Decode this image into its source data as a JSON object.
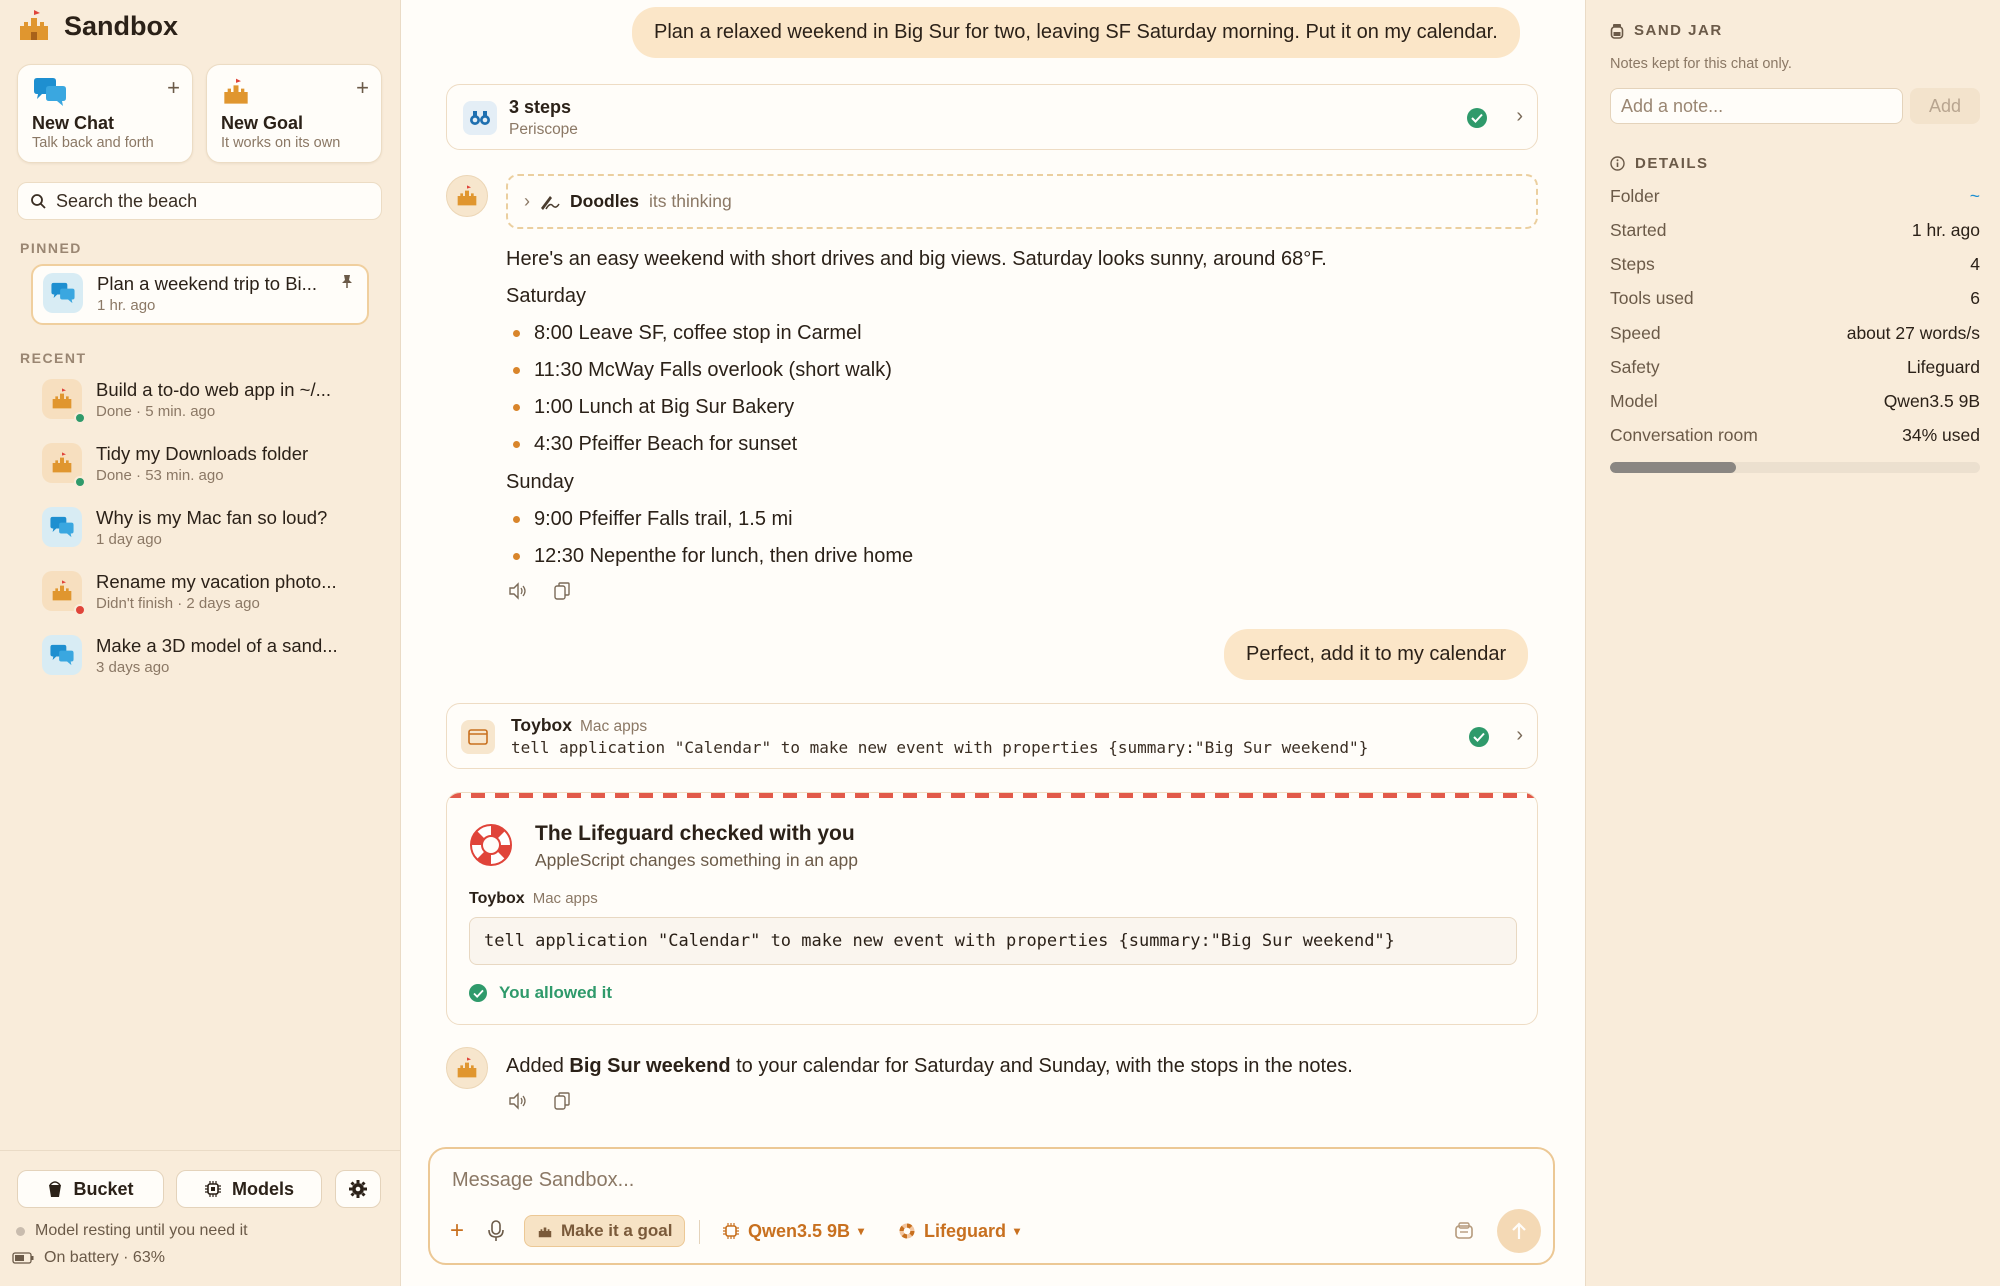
{
  "app": {
    "name": "Sandbox"
  },
  "sidebar": {
    "new_chat": {
      "title": "New Chat",
      "subtitle": "Talk back and forth"
    },
    "new_goal": {
      "title": "New Goal",
      "subtitle": "It works on its own"
    },
    "search_placeholder": "Search the beach",
    "pinned_label": "PINNED",
    "recent_label": "RECENT",
    "pinned": {
      "title": "Plan a weekend trip to Bi...",
      "sub": "1 hr. ago",
      "icon": "chat-bubbles-icon"
    },
    "recent": [
      {
        "title": "Build a to-do web app in ~/...",
        "sub": "Done · 5 min. ago",
        "icon": "sandcastle-icon",
        "status": "#2f9a6b"
      },
      {
        "title": "Tidy my Downloads folder",
        "sub": "Done · 53 min. ago",
        "icon": "sandcastle-icon",
        "status": "#2f9a6b"
      },
      {
        "title": "Why is my Mac fan so loud?",
        "sub": "1 day ago",
        "icon": "chat-bubbles-icon"
      },
      {
        "title": "Rename my vacation photo...",
        "sub": "Didn't finish · 2 days ago",
        "icon": "sandcastle-icon",
        "status": "#e0443a"
      },
      {
        "title": "Make a 3D model of a sand...",
        "sub": "3 days ago",
        "icon": "chat-bubbles-icon"
      }
    ],
    "bucket_label": "Bucket",
    "models_label": "Models",
    "model_status": "Model resting until you need it",
    "battery_status": "On battery · 63%"
  },
  "chat": {
    "user_msg_1": "Plan a relaxed weekend in Big Sur for two, leaving SF Saturday morning. Put it on my calendar.",
    "steps": {
      "title": "3 steps",
      "subtitle": "Periscope"
    },
    "thinking": {
      "name": "Doodles",
      "label": "its thinking"
    },
    "intro": "Here's an easy weekend with short drives and big views. Saturday looks sunny, around 68°F.",
    "saturday_heading": "Saturday",
    "saturday": [
      "8:00 Leave SF, coffee stop in Carmel",
      "11:30 McWay Falls overlook (short walk)",
      "1:00 Lunch at Big Sur Bakery",
      "4:30 Pfeiffer Beach for sunset"
    ],
    "sunday_heading": "Sunday",
    "sunday": [
      "9:00 Pfeiffer Falls trail, 1.5 mi",
      "12:30 Nepenthe for lunch, then drive home"
    ],
    "user_msg_2": "Perfect, add it to my calendar",
    "tool": {
      "name": "Toybox",
      "category": "Mac apps",
      "command": "tell application \"Calendar\" to make new event with properties {summary:\"Big Sur weekend\"}"
    },
    "lifeguard": {
      "title": "The Lifeguard checked with you",
      "subtitle": "AppleScript changes something in an app",
      "tool_name": "Toybox",
      "tool_category": "Mac apps",
      "command": "tell application \"Calendar\" to make new event with properties {summary:\"Big Sur weekend\"}",
      "result": "You allowed it"
    },
    "final": {
      "before": "Added ",
      "bold": "Big Sur weekend",
      "after": " to your calendar for Saturday and Sunday, with the stops in the notes."
    }
  },
  "composer": {
    "placeholder": "Message Sandbox...",
    "goal_label": "Make it a goal",
    "model_label": "Qwen3.5 9B",
    "safety_label": "Lifeguard"
  },
  "right": {
    "jar_title": "SAND JAR",
    "jar_sub": "Notes kept for this chat only.",
    "note_placeholder": "Add a note...",
    "add_label": "Add",
    "details_title": "DETAILS",
    "details": [
      {
        "k": "Folder",
        "v": "~"
      },
      {
        "k": "Started",
        "v": "1 hr. ago"
      },
      {
        "k": "Steps",
        "v": "4"
      },
      {
        "k": "Tools used",
        "v": "6"
      },
      {
        "k": "Speed",
        "v": "about 27 words/s"
      },
      {
        "k": "Safety",
        "v": "Lifeguard"
      },
      {
        "k": "Model",
        "v": "Qwen3.5 9B"
      },
      {
        "k": "Conversation room",
        "v": "34% used"
      }
    ],
    "room_used_fraction": 0.34
  },
  "colors": {
    "accent": "#c8701f",
    "success": "#2f9a6b",
    "danger": "#e0443a",
    "bubble": "#fbe6c8",
    "chat_blue": "#1e8fd0"
  }
}
